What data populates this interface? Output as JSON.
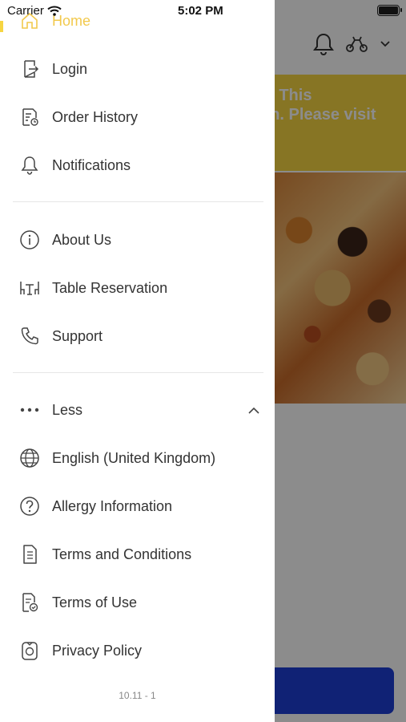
{
  "status_bar": {
    "carrier": "Carrier",
    "time": "5:02 PM"
  },
  "background": {
    "banner_lines": [
      "d, This",
      "on. Please visit"
    ]
  },
  "drawer": {
    "home_label": "Home",
    "group1": [
      {
        "label": "Login",
        "icon": "login-icon"
      },
      {
        "label": "Order History",
        "icon": "order-history-icon"
      },
      {
        "label": "Notifications",
        "icon": "bell-icon"
      }
    ],
    "group2": [
      {
        "label": "About Us",
        "icon": "info-icon"
      },
      {
        "label": "Table Reservation",
        "icon": "table-icon"
      },
      {
        "label": "Support",
        "icon": "phone-icon"
      }
    ],
    "less_label": "Less",
    "group3": [
      {
        "label": "English (United Kingdom)",
        "icon": "globe-icon"
      },
      {
        "label": "Allergy Information",
        "icon": "question-icon"
      },
      {
        "label": "Terms and Conditions",
        "icon": "document-icon"
      },
      {
        "label": "Terms of Use",
        "icon": "document-check-icon"
      },
      {
        "label": "Privacy Policy",
        "icon": "privacy-icon"
      }
    ],
    "version": "10.11 - 1"
  },
  "colors": {
    "accent": "#f6d542",
    "primary_button": "#1e3fd6"
  }
}
